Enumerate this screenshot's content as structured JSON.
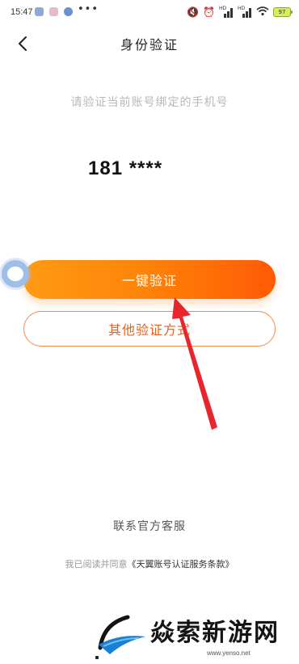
{
  "status_bar": {
    "time": "15:47",
    "more": "•••",
    "hd1": "HD",
    "hd2": "HD",
    "battery": "97"
  },
  "header": {
    "title": "身份验证",
    "back_icon": "chevron-left-icon"
  },
  "main": {
    "subtitle": "请验证当前账号绑定的手机号",
    "phone_number": "181 ****",
    "primary_button": "一键验证",
    "secondary_button": "其他验证方式"
  },
  "footer": {
    "contact": "联系官方客服",
    "agreement_prefix": "我已阅读并同意",
    "agreement_link": "《天翼账号认证服务条款》"
  },
  "watermark": {
    "text": "焱索新游网",
    "url": "www.yenso.net"
  },
  "colors": {
    "accent": "#ff8508",
    "accent_end": "#ff5a05",
    "secondary_border": "#f08a4b",
    "secondary_text": "#e4621f",
    "arrow": "#e8252d"
  }
}
